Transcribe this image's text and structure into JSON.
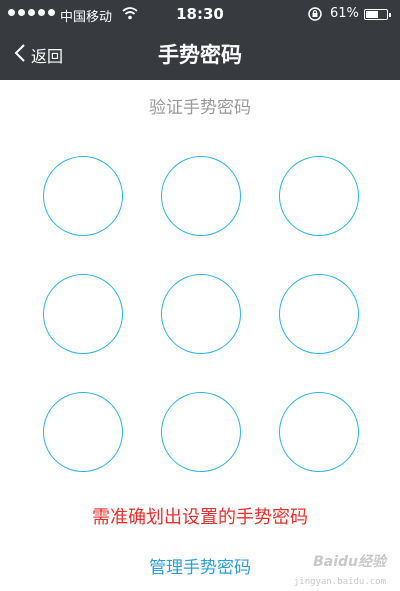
{
  "status_bar": {
    "carrier": "中国移动",
    "time": "18:30",
    "battery_percent": "61%",
    "battery_level": 0.61,
    "icons": [
      "signal-dots-icon",
      "wifi-icon",
      "rotation-lock-icon",
      "battery-icon"
    ]
  },
  "nav": {
    "back_label": "返回",
    "title": "手势密码"
  },
  "gesture": {
    "prompt": "验证手势密码",
    "nodes": [
      "1",
      "2",
      "3",
      "4",
      "5",
      "6",
      "7",
      "8",
      "9"
    ],
    "error": "需准确划出设置的手势密码",
    "manage_link": "管理手势密码"
  },
  "watermark": {
    "brand": "Baidu经验",
    "url": "jingyan.baidu.com"
  },
  "colors": {
    "bar_bg": "#373b40",
    "node_border": "#2fb3e0",
    "error": "#e8302c",
    "link": "#2a9fd8",
    "subtitle": "#9a9a9a"
  }
}
